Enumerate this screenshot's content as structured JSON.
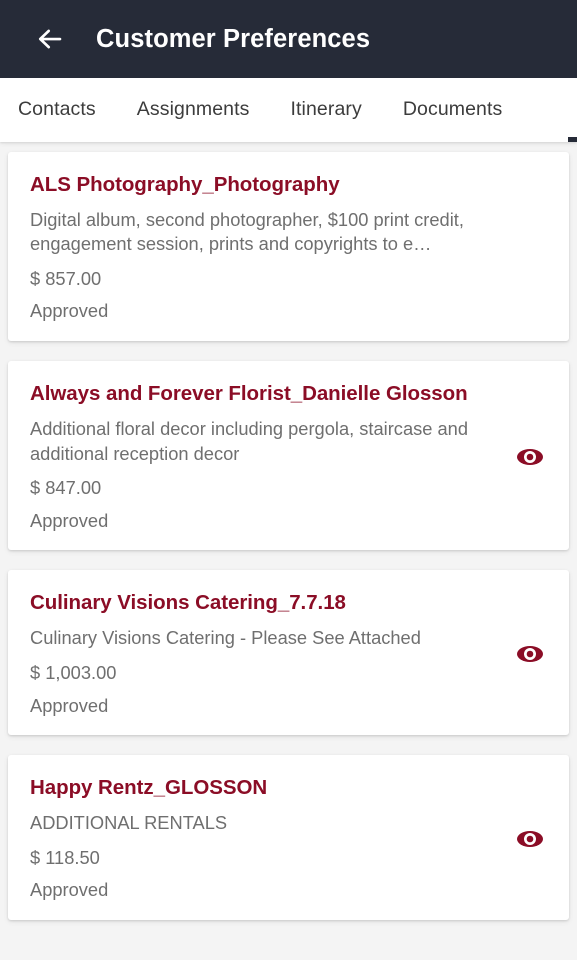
{
  "appbar": {
    "back_icon": "arrow-left-icon",
    "title": "Customer Preferences",
    "background": "#262b38",
    "text_color": "#ffffff"
  },
  "tabs": {
    "items": [
      {
        "label": "Contacts"
      },
      {
        "label": "Assignments"
      },
      {
        "label": "Itinerary"
      },
      {
        "label": "Documents"
      }
    ],
    "indicator_color": "#262b38"
  },
  "theme": {
    "accent": "#8b0d26",
    "muted_text": "#6f6f6f",
    "page_background": "#f4f4f4",
    "card_background": "#ffffff"
  },
  "cards": [
    {
      "title": "ALS Photography_Photography",
      "description": "Digital album, second photographer, $100 print credit, engagement session, prints and copyrights to e…",
      "price": "$ 857.00",
      "status": "Approved",
      "has_eye_icon": false,
      "eye_icon": "eye-icon"
    },
    {
      "title": "Always and Forever Florist_Danielle Glosson",
      "description": "Additional floral decor including pergola, staircase and additional reception decor",
      "price": "$ 847.00",
      "status": "Approved",
      "has_eye_icon": true,
      "eye_icon": "eye-icon"
    },
    {
      "title": "Culinary Visions Catering_7.7.18",
      "description": "Culinary Visions Catering - Please See Attached",
      "price": "$ 1,003.00",
      "status": "Approved",
      "has_eye_icon": true,
      "eye_icon": "eye-icon"
    },
    {
      "title": "Happy Rentz_GLOSSON",
      "description": "ADDITIONAL RENTALS",
      "price": "$ 118.50",
      "status": "Approved",
      "has_eye_icon": true,
      "eye_icon": "eye-icon"
    }
  ]
}
